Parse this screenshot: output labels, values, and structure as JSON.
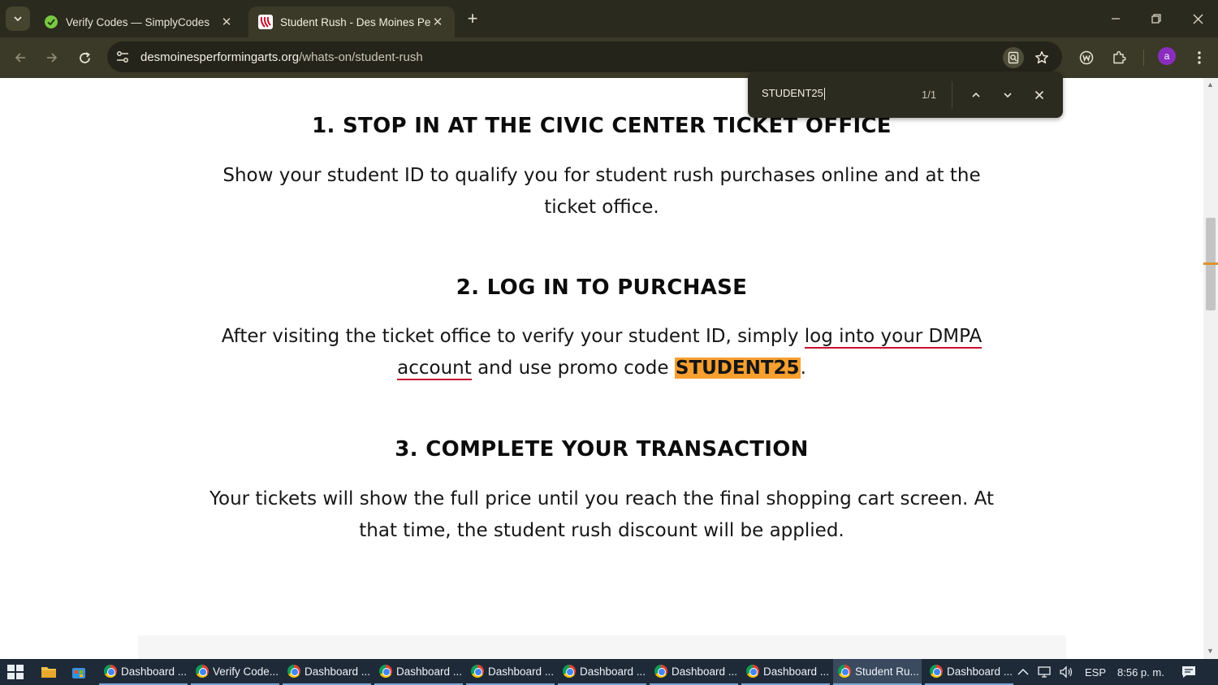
{
  "browser": {
    "tabs": [
      {
        "title": "Verify Codes — SimplyCodes",
        "favicon": "simplycodes-icon",
        "active": false
      },
      {
        "title": "Student Rush - Des Moines Perf",
        "favicon": "dmpa-icon",
        "active": true
      }
    ],
    "new_tab_label": "+",
    "url_host": "desmoinesperformingarts.org",
    "url_path": "/whats-on/student-rush",
    "profile_initial": "a"
  },
  "find_bar": {
    "query": "STUDENT25",
    "count": "1/1"
  },
  "page": {
    "steps": [
      {
        "heading": "1. STOP IN AT THE CIVIC CENTER TICKET OFFICE",
        "text": "Show your student ID to qualify you for student rush purchases online and at the ticket office."
      },
      {
        "heading": "2. LOG IN TO PURCHASE",
        "text_before_link": "After visiting the ticket office to verify your student ID, simply ",
        "link_text": "log into your DMPA account",
        "text_middle": " and use promo code ",
        "promo_code": "STUDENT25",
        "text_after": "."
      },
      {
        "heading": "3. COMPLETE YOUR TRANSACTION",
        "text": "Your tickets will show the full price until you reach the final shopping cart screen. At that time, the student rush discount will be applied."
      }
    ],
    "colors": {
      "link_underline": "#c8102e",
      "find_highlight": "#f7a02f"
    }
  },
  "taskbar": {
    "items": [
      {
        "label": "Dashboard ...",
        "active": false
      },
      {
        "label": "Verify Code...",
        "active": false
      },
      {
        "label": "Dashboard ...",
        "active": false
      },
      {
        "label": "Dashboard ...",
        "active": false
      },
      {
        "label": "Dashboard ...",
        "active": false
      },
      {
        "label": "Dashboard ...",
        "active": false
      },
      {
        "label": "Dashboard ...",
        "active": false
      },
      {
        "label": "Dashboard ...",
        "active": false
      },
      {
        "label": "Student Ru...",
        "active": true
      },
      {
        "label": "Dashboard ...",
        "active": false
      }
    ],
    "language": "ESP",
    "time": "8:56 p. m."
  }
}
